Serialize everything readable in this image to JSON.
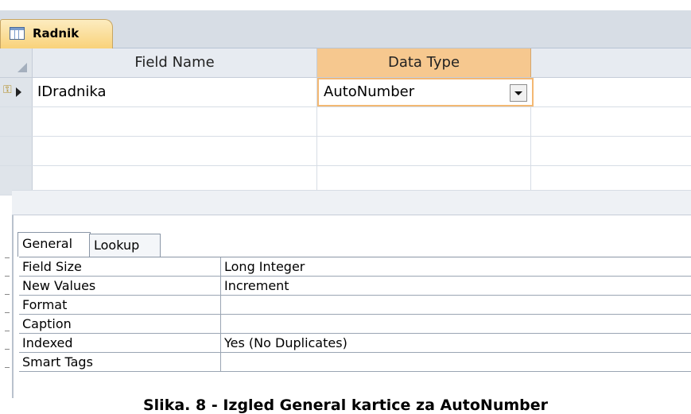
{
  "document_tab": {
    "label": "Radnik",
    "icon": "table-icon"
  },
  "grid": {
    "headers": {
      "field_name": "Field Name",
      "data_type": "Data Type"
    },
    "rows": [
      {
        "field_name": "IDradnika",
        "data_type": "AutoNumber",
        "primary_key": true,
        "current": true
      }
    ]
  },
  "properties": {
    "tabs": [
      {
        "label": "General",
        "active": true
      },
      {
        "label": "Lookup",
        "active": false
      }
    ],
    "items": [
      {
        "label": "Field Size",
        "value": "Long Integer"
      },
      {
        "label": "New Values",
        "value": "Increment"
      },
      {
        "label": "Format",
        "value": ""
      },
      {
        "label": "Caption",
        "value": ""
      },
      {
        "label": "Indexed",
        "value": "Yes (No Duplicates)"
      },
      {
        "label": "Smart Tags",
        "value": ""
      }
    ]
  },
  "caption": "Slika. 8 - Izgled General kartice za AutoNumber",
  "colors": {
    "tab_accent": "#f9d27a",
    "column_highlight": "#f6c88f",
    "grid_border": "#c6cdd8"
  }
}
